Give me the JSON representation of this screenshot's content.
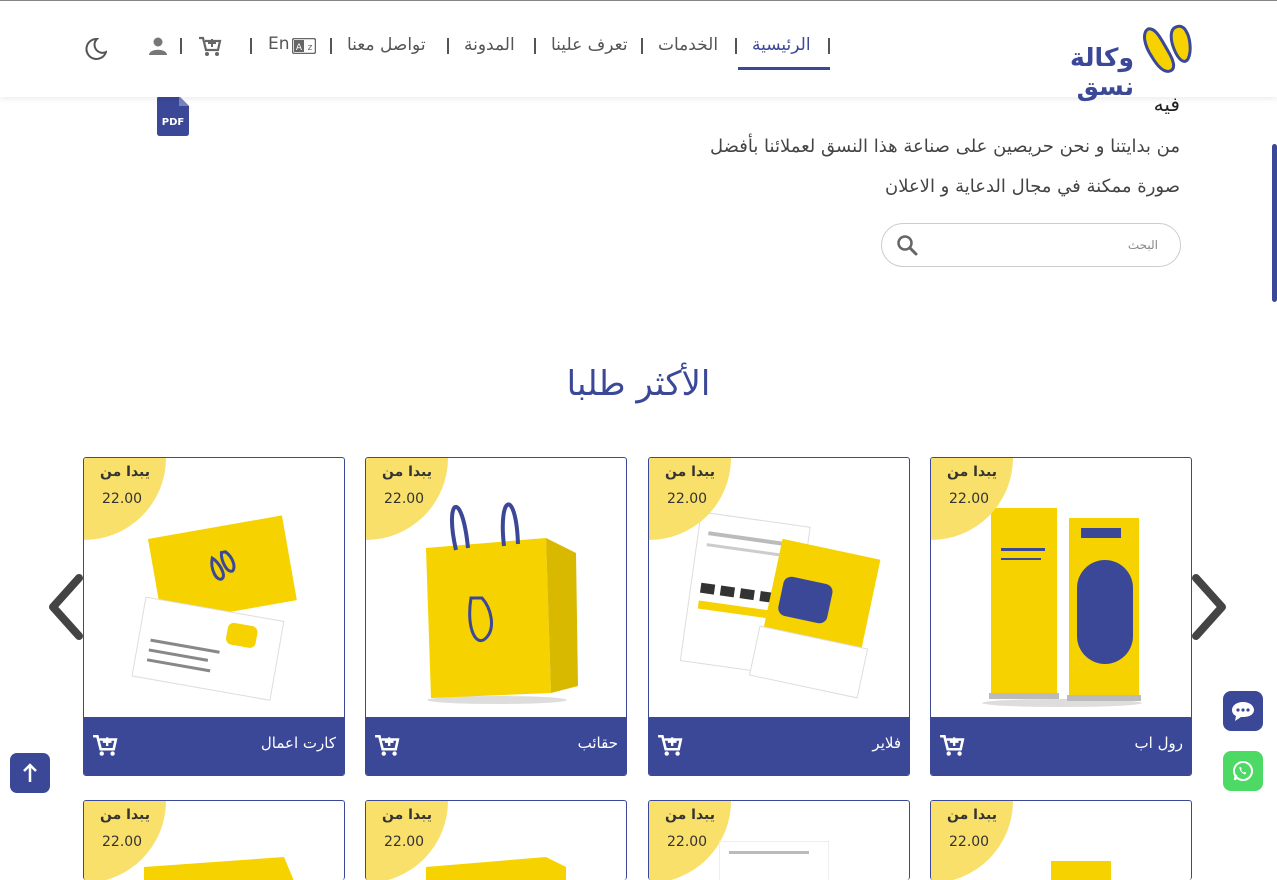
{
  "brand": {
    "name": "وكالة نسق",
    "primary": "#3b4898",
    "accent": "#f5d200"
  },
  "nav": {
    "home": "الرئيسية",
    "services": "الخدمات",
    "about": "تعرف علينا",
    "blog": "المدونة",
    "contact": "تواصل معنا",
    "lang": "En"
  },
  "icons": {
    "theme": "moon-icon",
    "user": "user-icon",
    "cart": "cart-plus-icon",
    "lang": "language-card-icon",
    "pdf": "pdf-file-icon",
    "search": "search-icon",
    "chat": "chat-bubble-icon",
    "whatsapp": "whatsapp-icon",
    "scroll_top": "arrow-up-icon"
  },
  "hero": {
    "title_fragment": "فيه",
    "line1": "من بدايتنا و نحن حريصين على صناعة هذا النسق لعملائنا بأفضل",
    "line2": "صورة ممكنة في مجال الدعاية و الاعلان"
  },
  "search": {
    "placeholder": "البحث"
  },
  "section": {
    "title": "الأكثر طلبا"
  },
  "products": [
    {
      "name": "رول اب",
      "price_label": "يبدا من",
      "price": "22.00"
    },
    {
      "name": "فلاير",
      "price_label": "يبدا من",
      "price": "22.00"
    },
    {
      "name": "حقائب",
      "price_label": "يبدا من",
      "price": "22.00"
    },
    {
      "name": "كارت اعمال",
      "price_label": "يبدا من",
      "price": "22.00"
    }
  ],
  "products_row2": [
    {
      "price_label": "يبدا من",
      "price": "22.00"
    },
    {
      "price_label": "يبدا من",
      "price": "22.00"
    },
    {
      "price_label": "يبدا من",
      "price": "22.00"
    },
    {
      "price_label": "يبدا من",
      "price": "22.00"
    }
  ]
}
